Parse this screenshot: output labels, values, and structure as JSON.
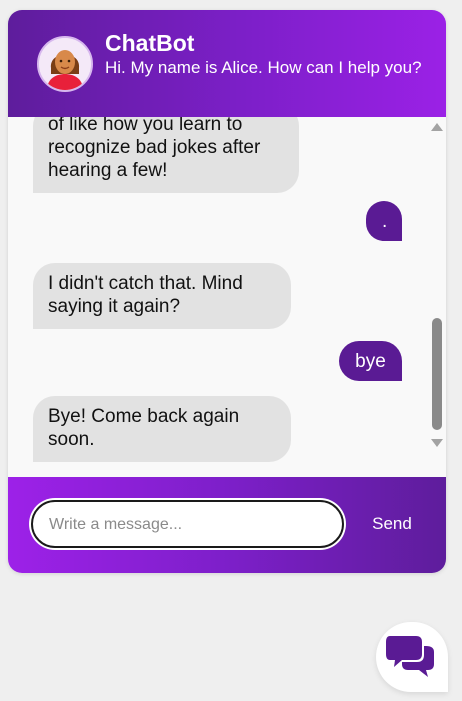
{
  "header": {
    "title": "ChatBot",
    "subtitle": "Hi. My name is Alice. How can I help you?",
    "avatar_icon": "woman-avatar-icon"
  },
  "messages": [
    {
      "sender": "bot",
      "text": "of like how you learn to recognize bad jokes after hearing a few!"
    },
    {
      "sender": "user",
      "text": "."
    },
    {
      "sender": "bot",
      "text": "I didn't catch that. Mind saying it again?"
    },
    {
      "sender": "user",
      "text": "bye"
    },
    {
      "sender": "bot",
      "text": "Bye! Come back again soon."
    }
  ],
  "composer": {
    "placeholder": "Write a message...",
    "value": "",
    "send_label": "Send"
  },
  "launcher": {
    "icon": "chat-bubbles-icon"
  },
  "colors": {
    "brand_dark": "#5a1b94",
    "brand_light": "#9b21e6",
    "bot_bubble": "#e2e2e2",
    "background": "#efefef"
  }
}
